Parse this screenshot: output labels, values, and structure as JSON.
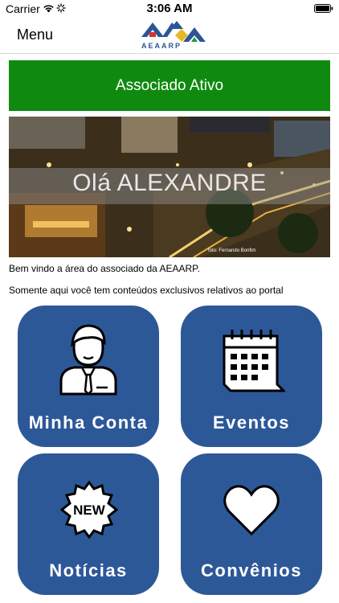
{
  "status_bar": {
    "carrier": "Carrier",
    "time": "3:06 AM"
  },
  "nav": {
    "menu_label": "Menu",
    "logo_text": "AEAARP"
  },
  "banner": {
    "text": "Associado Ativo",
    "color": "#0f8a0f"
  },
  "hero": {
    "greeting": "Olá ALEXANDRE",
    "photo_credit": "foto: Fernando Bonfim"
  },
  "intro": {
    "welcome": "Bem vindo a área do associado da AEAARP.",
    "exclusive": "Somente aqui você tem conteúdos exclusivos relativos ao portal"
  },
  "tiles": [
    {
      "label": "Minha Conta",
      "icon": "user-icon"
    },
    {
      "label": "Eventos",
      "icon": "calendar-icon"
    },
    {
      "label": "Notícias",
      "icon": "new-badge-icon"
    },
    {
      "label": "Convênios",
      "icon": "heart-icon"
    }
  ],
  "colors": {
    "tile": "#2d5898",
    "brand_blue": "#2b5597"
  }
}
